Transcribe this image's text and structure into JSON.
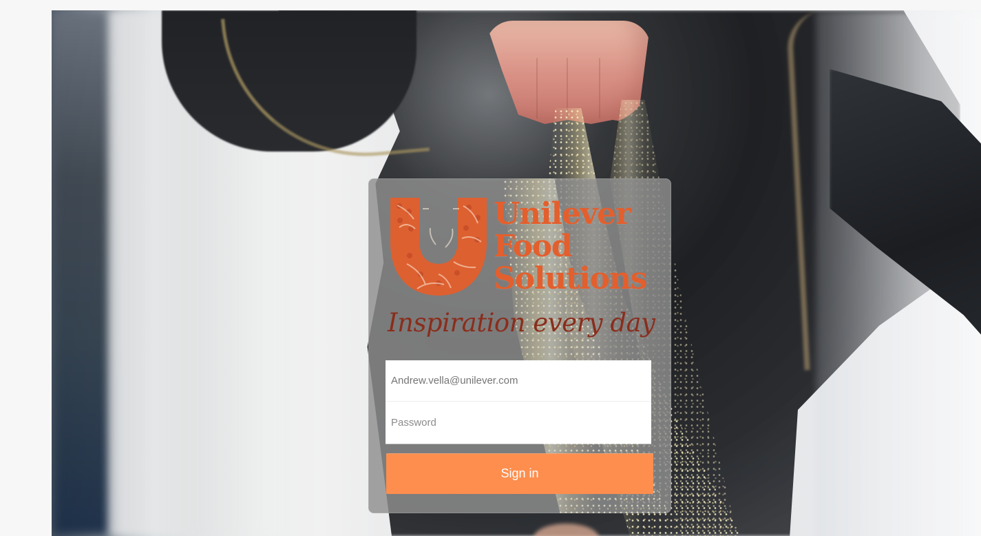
{
  "brand": {
    "line1": "Unilever",
    "line2": "Food",
    "line3": "Solutions",
    "tagline": "Inspiration every day",
    "accent_color": "#e35f2d",
    "tagline_color": "#8a2d1c"
  },
  "login": {
    "email_value": "Andrew.vella@unilever.com",
    "password_placeholder": "Password",
    "sign_in_label": "Sign in",
    "button_color": "#fd8e4e"
  },
  "icons": {
    "logo": "unilever-u-icon"
  }
}
